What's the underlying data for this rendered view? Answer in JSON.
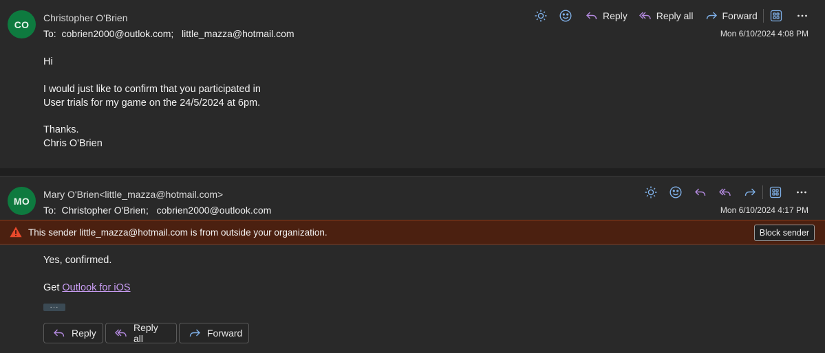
{
  "messages": [
    {
      "avatar_initials": "CO",
      "sender": "Christopher O'Brien",
      "recipients": "To:  cobrien2000@outlok.com;   little_mazza@hotmail.com",
      "date": "Mon 6/10/2024 4:08 PM",
      "toolbar": {
        "reply": "Reply",
        "reply_all": "Reply all",
        "forward": "Forward"
      },
      "body": [
        "Hi",
        "I would just like to confirm that you participated in",
        "User trials for my game on the 24/5/2024 at 6pm.",
        "Thanks.",
        "Chris O'Brien"
      ]
    },
    {
      "avatar_initials": "MO",
      "sender": "Mary O'Brien<little_mazza@hotmail.com>",
      "recipients": "To:  Christopher O'Brien;   cobrien2000@outlook.com",
      "date": "Mon 6/10/2024 4:17 PM",
      "warning": {
        "text": "This sender little_mazza@hotmail.com is from outside your organization.",
        "block_button": "Block sender"
      },
      "body": {
        "line1": "Yes, confirmed.",
        "get_prefix": "Get ",
        "link_text": "Outlook for iOS"
      },
      "dots": "···",
      "actions": {
        "reply": "Reply",
        "reply_all": "Reply all",
        "forward": "Forward"
      }
    }
  ],
  "colors": {
    "avatar": "#0e7a3f",
    "icon_purple": "#b48ae0",
    "icon_blue": "#7fb0e8",
    "link": "#c89cf2",
    "warning_bg": "#4b2010",
    "warning_icon": "#e8492b"
  },
  "icons": [
    "sun-icon",
    "emoji-icon",
    "reply-icon",
    "reply-all-icon",
    "forward-icon",
    "apps-icon",
    "more-icon",
    "warning-icon"
  ]
}
